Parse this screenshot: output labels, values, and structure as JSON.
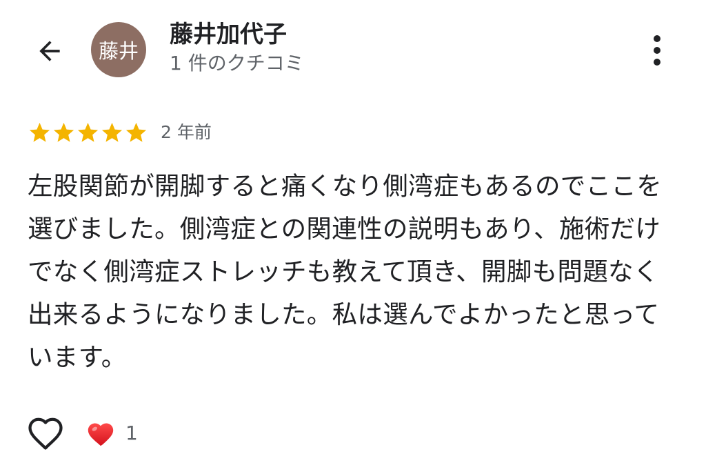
{
  "header": {
    "back_icon": "arrow-left-icon",
    "avatar_text": "藤井",
    "avatar_color": "#8d6e63",
    "user_name": "藤井加代子",
    "review_count": "1 件のクチコミ",
    "more_icon": "more-vertical-icon"
  },
  "review": {
    "rating": 5,
    "rating_max": 5,
    "star_color": "#f4b400",
    "date": "2 年前",
    "text": "左股関節が開脚すると痛くなり側湾症もあるのでここを選びました。側湾症との関連性の説明もあり、施術だけでなく側湾症ストレッチも教えて頂き、開脚も問題なく出来るようになりました。私は選んでよかったと思っています。"
  },
  "actions": {
    "like_icon": "heart-outline-icon",
    "reaction_icon": "red-heart-icon",
    "reaction_color": "#e8202a",
    "reaction_count": "1"
  }
}
